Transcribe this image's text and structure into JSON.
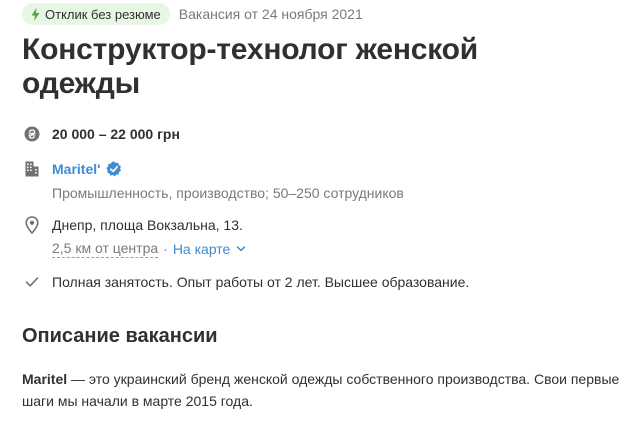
{
  "badge": {
    "label": "Отклик без резюме",
    "icon": "lightning-icon",
    "color": "#e8f7e5"
  },
  "posted": "Вакансия от 24 ноября 2021",
  "title": "Конструктор-технолог женской одежды",
  "salary": {
    "icon": "hryvnia-icon",
    "text": "20 000 – 22 000 грн"
  },
  "company": {
    "icon": "building-icon",
    "name": "Maritel'",
    "verified_icon": "verified-check-icon",
    "industry": "Промышленность, производство; 50–250 сотрудников",
    "color": "#3f8cd3"
  },
  "location": {
    "icon": "map-pin-icon",
    "address": "Днепр, площа Вокзальна, 13.",
    "distance": "2,5 км от центра",
    "separator": "·",
    "map_link": "На карте"
  },
  "conditions": {
    "icon": "check-icon",
    "text": "Полная занятость. Опыт работы от 2 лет. Высшее образование."
  },
  "description": {
    "heading": "Описание вакансии",
    "brand": "Maritel",
    "text": " — это украинский бренд женской одежды собственного производства. Свои первые шаги мы начали в марте 2015 года."
  }
}
